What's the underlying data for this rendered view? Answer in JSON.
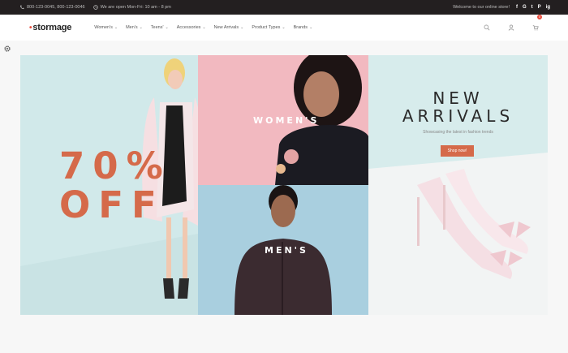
{
  "topbar": {
    "phone": "800-123-0045, 800-123-0046",
    "hours": "We are open Mon-Fri: 10 am - 8 pm",
    "welcome": "Welcome to our online store!",
    "social": [
      "f",
      "G",
      "t",
      "P",
      "ig"
    ]
  },
  "nav": {
    "logo": "stormage",
    "items": [
      {
        "label": "Women's"
      },
      {
        "label": "Men's"
      },
      {
        "label": "Teens'"
      },
      {
        "label": "Accessories"
      },
      {
        "label": "New Arrivals"
      },
      {
        "label": "Product Types"
      },
      {
        "label": "Brands"
      }
    ],
    "cart_count": "0"
  },
  "banner": {
    "sale_line1": "70%",
    "sale_line2": "OFF",
    "women_label": "WOMEN'S",
    "men_label": "MEN'S",
    "arrivals_line1": "NEW",
    "arrivals_line2": "ARRIVALS",
    "arrivals_sub": "Showcasing the latest in fashion trends",
    "shop_button": "Shop now!"
  },
  "colors": {
    "accent": "#d56a4a",
    "topbar_bg": "#231f20",
    "left_panel": "#d1e9ea",
    "women_panel": "#f2b9c0",
    "men_panel": "#a9cfdf",
    "right_panel": "#d7ecec"
  }
}
